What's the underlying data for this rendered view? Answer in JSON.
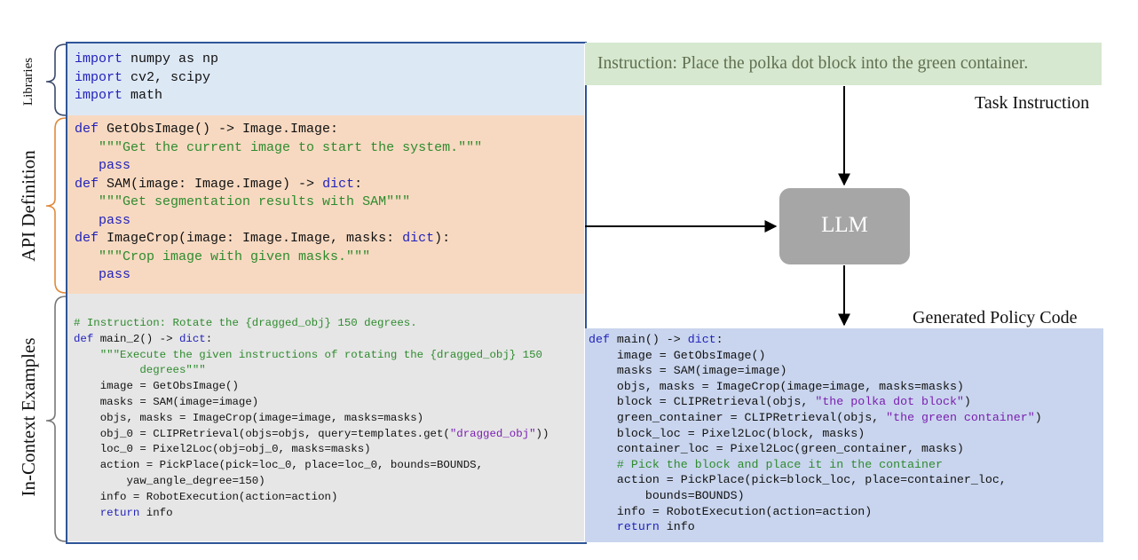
{
  "side_labels": {
    "libraries": "Libraries",
    "api": "API  Definition",
    "examples": "In-Context Examples"
  },
  "colors": {
    "libraries_bg": "#dde8f5",
    "api_bg": "#f7d9c1",
    "examples_bg": "#e6e6e6",
    "instruction_bg": "#d6e8cf",
    "llm_bg": "#a6a6a6",
    "policy_bg": "#c9d5ee",
    "frame": "#2f5597",
    "keyword": "#2222bb",
    "string": "#2e8b2e"
  },
  "libraries_code": [
    [
      [
        "kw",
        "import"
      ],
      [
        "t",
        " numpy as np"
      ]
    ],
    [
      [
        "kw",
        "import"
      ],
      [
        "t",
        " cv2, scipy"
      ]
    ],
    [
      [
        "kw",
        "import"
      ],
      [
        "t",
        " math"
      ]
    ]
  ],
  "api_code": [
    [
      [
        "kw",
        "def"
      ],
      [
        "t",
        " GetObsImage() -> Image.Image:"
      ]
    ],
    [
      [
        "t",
        "   "
      ],
      [
        "str",
        "\"\"\"Get the current image to start the system.\"\"\""
      ]
    ],
    [
      [
        "t",
        "   "
      ],
      [
        "kw",
        "pass"
      ]
    ],
    [
      [
        "kw",
        "def"
      ],
      [
        "t",
        " SAM(image: Image.Image) -> "
      ],
      [
        "kw",
        "dict"
      ],
      [
        "t",
        ":"
      ]
    ],
    [
      [
        "t",
        "   "
      ],
      [
        "str",
        "\"\"\"Get segmentation results with SAM\"\"\""
      ]
    ],
    [
      [
        "t",
        "   "
      ],
      [
        "kw",
        "pass"
      ]
    ],
    [
      [
        "kw",
        "def"
      ],
      [
        "t",
        " ImageCrop(image: Image.Image, masks: "
      ],
      [
        "kw",
        "dict"
      ],
      [
        "t",
        "):"
      ]
    ],
    [
      [
        "t",
        "   "
      ],
      [
        "str",
        "\"\"\"Crop image with given masks.\"\"\""
      ]
    ],
    [
      [
        "t",
        "   "
      ],
      [
        "kw",
        "pass"
      ]
    ]
  ],
  "examples_code": [
    [
      [
        "cm",
        "# Instruction: Rotate the {dragged_obj} 150 degrees."
      ]
    ],
    [
      [
        "kw",
        "def"
      ],
      [
        "t",
        " main_2() -> "
      ],
      [
        "kw",
        "dict"
      ],
      [
        "t",
        ":"
      ]
    ],
    [
      [
        "t",
        "    "
      ],
      [
        "str",
        "\"\"\"Execute the given instructions of rotating the {dragged_obj} 150"
      ]
    ],
    [
      [
        "t",
        "          "
      ],
      [
        "str",
        "degrees\"\"\""
      ]
    ],
    [
      [
        "t",
        "    image = GetObsImage()"
      ]
    ],
    [
      [
        "t",
        "    masks = SAM(image=image)"
      ]
    ],
    [
      [
        "t",
        "    objs, masks = ImageCrop(image=image, masks=masks)"
      ]
    ],
    [
      [
        "t",
        "    obj_0 = CLIPRetrieval(objs=objs, query=templates.get("
      ],
      [
        "pur",
        "\"dragged_obj\""
      ],
      [
        "t",
        "))"
      ]
    ],
    [
      [
        "t",
        "    loc_0 = Pixel2Loc(obj=obj_0, masks=masks)"
      ]
    ],
    [
      [
        "t",
        "    action = PickPlace(pick=loc_0, place=loc_0, bounds=BOUNDS,"
      ]
    ],
    [
      [
        "t",
        "        yaw_angle_degree=150)"
      ]
    ],
    [
      [
        "t",
        "    info = RobotExecution(action=action)"
      ]
    ],
    [
      [
        "t",
        "    "
      ],
      [
        "kw",
        "return"
      ],
      [
        "t",
        " info"
      ]
    ]
  ],
  "instruction_text": "Instruction: Place the polka dot block into the green container.",
  "task_instruction_label": "Task Instruction",
  "llm_label": "LLM",
  "generated_label": "Generated Policy Code",
  "policy_code": [
    [
      [
        "kw",
        "def"
      ],
      [
        "t",
        " main() -> "
      ],
      [
        "kw",
        "dict"
      ],
      [
        "t",
        ":"
      ]
    ],
    [
      [
        "t",
        "    image = GetObsImage()"
      ]
    ],
    [
      [
        "t",
        "    masks = SAM(image=image)"
      ]
    ],
    [
      [
        "t",
        "    objs, masks = ImageCrop(image=image, masks=masks)"
      ]
    ],
    [
      [
        "t",
        "    block = CLIPRetrieval(objs, "
      ],
      [
        "pur",
        "\"the polka dot block\""
      ],
      [
        "t",
        ")"
      ]
    ],
    [
      [
        "t",
        "    green_container = CLIPRetrieval(objs, "
      ],
      [
        "pur",
        "\"the green container\""
      ],
      [
        "t",
        ")"
      ]
    ],
    [
      [
        "t",
        "    block_loc = Pixel2Loc(block, masks)"
      ]
    ],
    [
      [
        "t",
        "    container_loc = Pixel2Loc(green_container, masks)"
      ]
    ],
    [
      [
        "t",
        "    "
      ],
      [
        "cm",
        "# Pick the block and place it in the container"
      ]
    ],
    [
      [
        "t",
        "    action = PickPlace(pick=block_loc, place=container_loc,"
      ]
    ],
    [
      [
        "t",
        "        bounds=BOUNDS)"
      ]
    ],
    [
      [
        "t",
        "    info = RobotExecution(action=action)"
      ]
    ],
    [
      [
        "t",
        "    "
      ],
      [
        "kw",
        "return"
      ],
      [
        "t",
        " info"
      ]
    ]
  ]
}
